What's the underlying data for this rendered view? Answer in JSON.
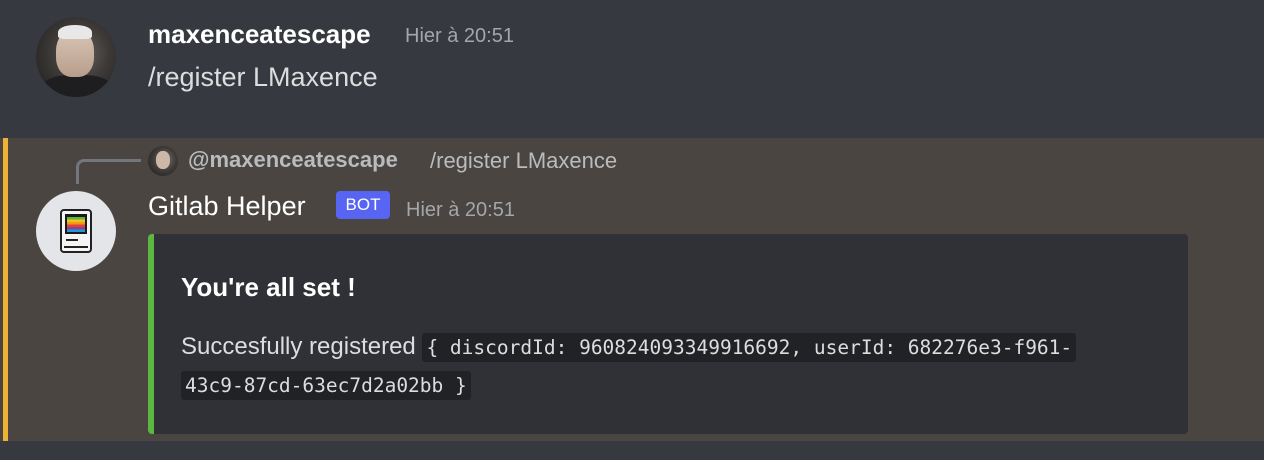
{
  "message_user": {
    "username": "maxenceatescape",
    "timestamp": "Hier à 20:51",
    "content": "/register LMaxence"
  },
  "message_bot": {
    "reply": {
      "mention": "@maxenceatescape",
      "content": "/register LMaxence"
    },
    "username": "Gitlab Helper",
    "badge": "BOT",
    "timestamp": "Hier à 20:51",
    "embed": {
      "accent_color": "#5bb73f",
      "title": "You're all set !",
      "description_prefix": "Succesfully registered",
      "code": "{ discordId: 960824093349916692, userId: 682276e3-f961-43c9-87cd-63ec7d2a02bb }"
    }
  },
  "colors": {
    "background": "#36393f",
    "highlight_background": "#4a4541",
    "mention_bar": "#f0b232",
    "bot_badge": "#5865f2",
    "embed_background": "#2f3136"
  }
}
